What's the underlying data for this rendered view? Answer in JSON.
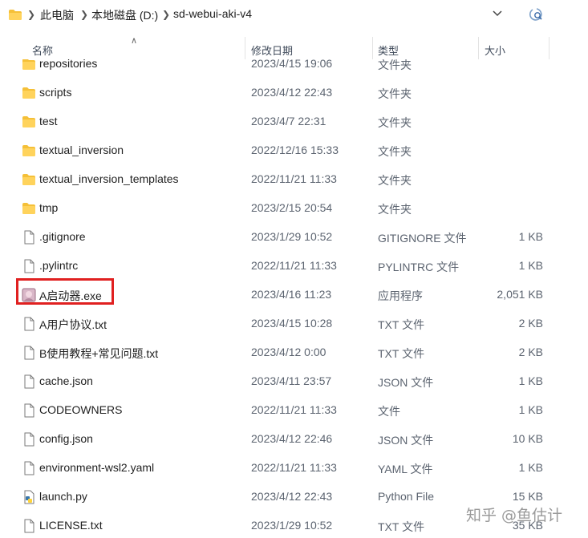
{
  "breadcrumb": {
    "items": [
      "此电脑",
      "本地磁盘 (D:)",
      "sd-webui-aki-v4"
    ]
  },
  "columns": {
    "name": "名称",
    "date": "修改日期",
    "type": "类型",
    "size": "大小"
  },
  "files": [
    {
      "name": "repositories",
      "date": "2023/4/15 19:06",
      "type": "文件夹",
      "size": "",
      "kind": "folder"
    },
    {
      "name": "scripts",
      "date": "2023/4/12 22:43",
      "type": "文件夹",
      "size": "",
      "kind": "folder"
    },
    {
      "name": "test",
      "date": "2023/4/7 22:31",
      "type": "文件夹",
      "size": "",
      "kind": "folder"
    },
    {
      "name": "textual_inversion",
      "date": "2022/12/16 15:33",
      "type": "文件夹",
      "size": "",
      "kind": "folder"
    },
    {
      "name": "textual_inversion_templates",
      "date": "2022/11/21 11:33",
      "type": "文件夹",
      "size": "",
      "kind": "folder"
    },
    {
      "name": "tmp",
      "date": "2023/2/15 20:54",
      "type": "文件夹",
      "size": "",
      "kind": "folder"
    },
    {
      "name": ".gitignore",
      "date": "2023/1/29 10:52",
      "type": "GITIGNORE 文件",
      "size": "1 KB",
      "kind": "file"
    },
    {
      "name": ".pylintrc",
      "date": "2022/11/21 11:33",
      "type": "PYLINTRC 文件",
      "size": "1 KB",
      "kind": "file"
    },
    {
      "name": "A启动器.exe",
      "date": "2023/4/16 11:23",
      "type": "应用程序",
      "size": "2,051 KB",
      "kind": "exe"
    },
    {
      "name": "A用户协议.txt",
      "date": "2023/4/15 10:28",
      "type": "TXT 文件",
      "size": "2 KB",
      "kind": "file"
    },
    {
      "name": "B使用教程+常见问题.txt",
      "date": "2023/4/12 0:00",
      "type": "TXT 文件",
      "size": "2 KB",
      "kind": "file"
    },
    {
      "name": "cache.json",
      "date": "2023/4/11 23:57",
      "type": "JSON 文件",
      "size": "1 KB",
      "kind": "file"
    },
    {
      "name": "CODEOWNERS",
      "date": "2022/11/21 11:33",
      "type": "文件",
      "size": "1 KB",
      "kind": "file"
    },
    {
      "name": "config.json",
      "date": "2023/4/12 22:46",
      "type": "JSON 文件",
      "size": "10 KB",
      "kind": "file"
    },
    {
      "name": "environment-wsl2.yaml",
      "date": "2022/11/21 11:33",
      "type": "YAML 文件",
      "size": "1 KB",
      "kind": "file"
    },
    {
      "name": "launch.py",
      "date": "2023/4/12 22:43",
      "type": "Python File",
      "size": "15 KB",
      "kind": "py"
    },
    {
      "name": "LICENSE.txt",
      "date": "2023/1/29 10:52",
      "type": "TXT 文件",
      "size": "35 KB",
      "kind": "file"
    }
  ],
  "watermark": "知乎 @鱼估计",
  "colors": {
    "folder": "#f5c038",
    "highlight": "#e02020",
    "accent": "#0067c0"
  }
}
